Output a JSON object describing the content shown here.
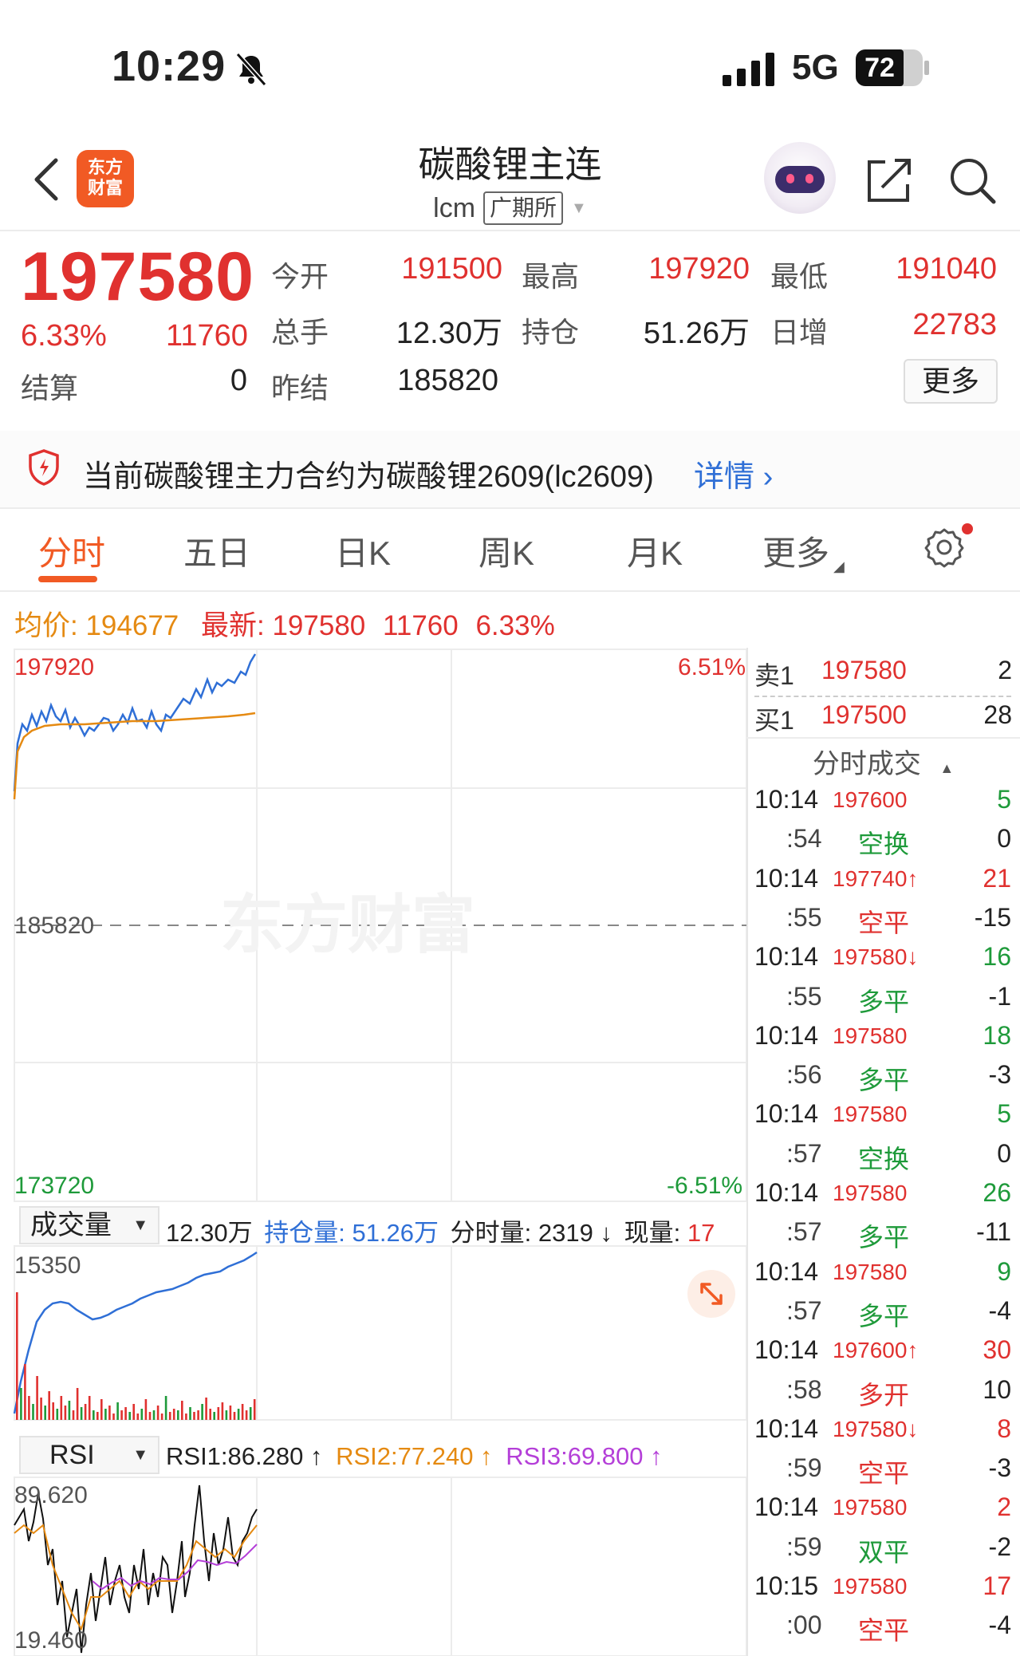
{
  "status": {
    "time": "10:29",
    "network": "5G",
    "battery": "72"
  },
  "header": {
    "logo_line1": "东方",
    "logo_line2": "财富",
    "title": "碳酸锂主连",
    "symbol": "lcm",
    "exchange": "广期所"
  },
  "quote": {
    "last": "197580",
    "change_pct": "6.33%",
    "change": "11760",
    "open_label": "今开",
    "open": "191500",
    "high_label": "最高",
    "high": "197920",
    "low_label": "最低",
    "low": "191040",
    "volume_label": "总手",
    "volume": "12.30万",
    "oi_label": "持仓",
    "oi": "51.26万",
    "daily_inc_label": "日增",
    "daily_inc": "22783",
    "settle_label": "结算",
    "settle": "0",
    "prev_settle_label": "昨结",
    "prev_settle": "185820",
    "more": "更多"
  },
  "notice": {
    "text": "当前碳酸锂主力合约为碳酸锂2609(lc2609)",
    "link": "详情"
  },
  "tabs": [
    "分时",
    "五日",
    "日K",
    "周K",
    "月K",
    "更多"
  ],
  "info": {
    "avg_label": "均价:",
    "avg": "194677",
    "latest_label": "最新:",
    "latest": "197580",
    "change": "11760",
    "pct": "6.33%"
  },
  "chart": {
    "y_top": "197920",
    "y_mid": "185820",
    "y_bottom": "173720",
    "pct_top": "6.51%",
    "pct_bottom": "-6.51%",
    "watermark": "东方财富",
    "vol_max": "15350",
    "rsi_max": "89.620",
    "rsi_min": "19.460"
  },
  "volume_bar": {
    "select": "成交量",
    "vol": "12.30万",
    "oi_label": "持仓量:",
    "oi": "51.26万",
    "tick_vol_label": "分时量:",
    "tick_vol": "2319 ↓",
    "now_label": "现量:",
    "now": "17"
  },
  "rsi_bar": {
    "select": "RSI",
    "rsi1": "RSI1:86.280 ↑",
    "rsi2": "RSI2:77.240 ↑",
    "rsi3": "RSI3:69.800 ↑"
  },
  "orderbook": {
    "ask_label": "卖1",
    "ask_price": "197580",
    "ask_vol": "2",
    "bid_label": "买1",
    "bid_price": "197500",
    "bid_vol": "28",
    "trades_header": "分时成交"
  },
  "trades": [
    {
      "time": "10:14",
      "price": "197600",
      "vol": "5",
      "vc": "green"
    },
    {
      "time": ":54",
      "kind": "空换",
      "vol": "0"
    },
    {
      "time": "10:14",
      "price": "197740↑",
      "vol": "21",
      "vc": "red"
    },
    {
      "time": ":55",
      "kind": "空平",
      "kc": "red",
      "vol": "-15"
    },
    {
      "time": "10:14",
      "price": "197580↓",
      "vol": "16",
      "vc": "green"
    },
    {
      "time": ":55",
      "kind": "多平",
      "vol": "-1"
    },
    {
      "time": "10:14",
      "price": "197580",
      "vol": "18",
      "vc": "green"
    },
    {
      "time": ":56",
      "kind": "多平",
      "vol": "-3"
    },
    {
      "time": "10:14",
      "price": "197580",
      "vol": "5",
      "vc": "green"
    },
    {
      "time": ":57",
      "kind": "空换",
      "vol": "0"
    },
    {
      "time": "10:14",
      "price": "197580",
      "vol": "26",
      "vc": "green"
    },
    {
      "time": ":57",
      "kind": "多平",
      "vol": "-11"
    },
    {
      "time": "10:14",
      "price": "197580",
      "vol": "9",
      "vc": "green"
    },
    {
      "time": ":57",
      "kind": "多平",
      "vol": "-4"
    },
    {
      "time": "10:14",
      "price": "197600↑",
      "vol": "30",
      "vc": "red"
    },
    {
      "time": ":58",
      "kind": "多开",
      "kc": "red",
      "vol": "10"
    },
    {
      "time": "10:14",
      "price": "197580↓",
      "vol": "8",
      "vc": "red"
    },
    {
      "time": ":59",
      "kind": "空平",
      "kc": "red",
      "vol": "-3"
    },
    {
      "time": "10:14",
      "price": "197580",
      "vol": "2",
      "vc": "red"
    },
    {
      "time": ":59",
      "kind": "双平",
      "vol": "-2"
    },
    {
      "time": "10:15",
      "price": "197580",
      "vol": "17",
      "vc": "red"
    },
    {
      "time": ":00",
      "kind": "空平",
      "kc": "red",
      "vol": "-4"
    }
  ],
  "colors": {
    "up": "#e0312f",
    "down": "#1e9a3a",
    "accent": "#f15a24",
    "price_line": "#2f6fd6",
    "avg_line": "#e58a12"
  }
}
